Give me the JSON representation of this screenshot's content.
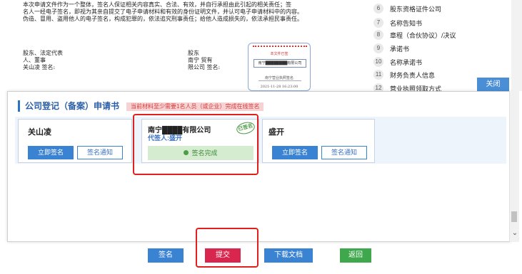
{
  "document": {
    "paragraph_lines": [
      "本次申请文件作为一个整体，签名人保证相关内容真实、合法、有效，并自行承担由此引起的相关责任；签",
      "名人一经电子签名，即视为其亲自提交了电子申请材料和有效的身份证明文件，并认可电子申请材料中的内容。",
      "伪造、冒用、盗用他人的电子签名，构成犯罪的，依法追究刑事责任；给他人造成损失的，依法承担民事责任。"
    ],
    "left_signature_lines": [
      "股东、法定代表",
      "人、董事",
      "关山凌 签名:"
    ],
    "middle_signature_lines": [
      "股东",
      "南宁      贸有",
      "限公司 签名:"
    ],
    "thumbnail": {
      "line1": "本文件已签",
      "box": "南宁████████有限公司",
      "line2": "南宁营业执照签名",
      "line3": "2021-11-28 16:23:00"
    }
  },
  "toc": {
    "items": [
      {
        "num": "6",
        "label": "股东资格证件公司"
      },
      {
        "num": "7",
        "label": "名称告知书"
      },
      {
        "num": "8",
        "label": "章程（合伙协议）/决议"
      },
      {
        "num": "9",
        "label": "承诺书"
      },
      {
        "num": "10",
        "label": "名称承诺书"
      },
      {
        "num": "11",
        "label": "财务负责人信息"
      },
      {
        "num": "12",
        "label": "营业执照领取方式"
      }
    ],
    "close_label": "关闭"
  },
  "panel": {
    "title": "公司登记（备案）申请书",
    "notice": "当前材料至少需要1名人员（或企业）完成在线签名",
    "signers": [
      {
        "name": "关山凌",
        "sign_label": "立即签名",
        "notify_label": "签名通知"
      },
      {
        "name": "南宁████有限公司",
        "agent": "代签人:盛开",
        "stamp": "已签名",
        "status": "签名完成"
      },
      {
        "name": "盛开",
        "sign_label": "立即签名",
        "notify_label": "签名通知"
      }
    ]
  },
  "actions": {
    "sign": "签名",
    "submit": "提交",
    "download": "下载文档",
    "back": "返回"
  },
  "colors": {
    "primary_blue": "#3a82d2",
    "submit_red": "#d9264f",
    "back_green": "#3fa84c",
    "highlight_red": "#e0201c",
    "done_green": "#3f8a3a"
  }
}
